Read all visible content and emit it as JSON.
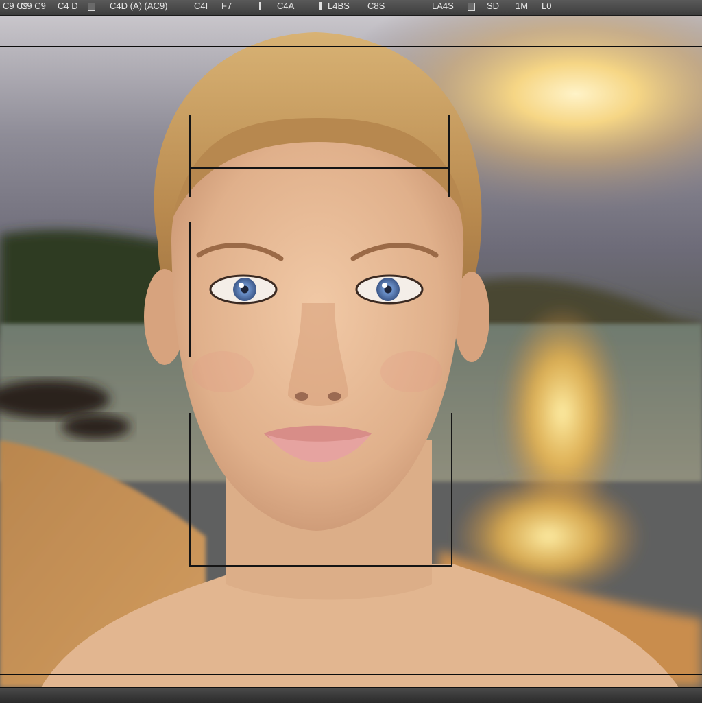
{
  "toolbar": {
    "items": [
      "C9 C9",
      "C9 C9",
      "C4 D",
      "C4D (A) (AC9)",
      "(AC9)",
      "C4I",
      "F7",
      "C4A",
      "L4BS",
      "C8S",
      "LA4S",
      "SD",
      "1M",
      "L0"
    ]
  },
  "viewport": {
    "scene_description_icon": "rendered-portrait-image",
    "accent_colors": {
      "sky": "#b9b7bd",
      "sunset": "#f4c25a",
      "sand": "#c4925c",
      "hair": "#c99a5c",
      "skin": "#e8b894",
      "eyes": "#5f86c4"
    }
  },
  "statusbar": {
    "label": ""
  }
}
